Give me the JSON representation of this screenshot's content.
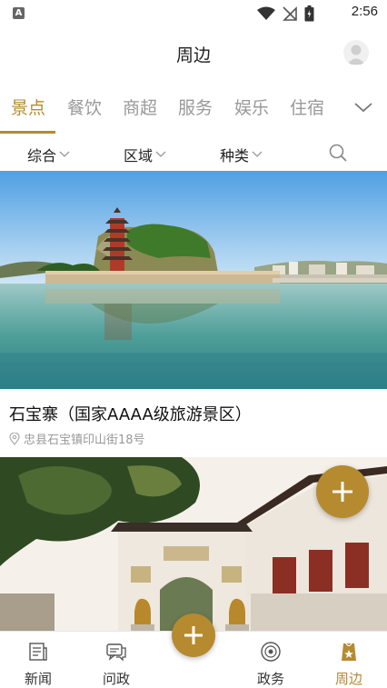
{
  "status_bar": {
    "time": "2:56",
    "notification_letter": "A"
  },
  "header": {
    "title": "周边"
  },
  "category_tabs": [
    {
      "label": "景点",
      "active": true
    },
    {
      "label": "餐饮",
      "active": false
    },
    {
      "label": "商超",
      "active": false
    },
    {
      "label": "服务",
      "active": false
    },
    {
      "label": "娱乐",
      "active": false
    },
    {
      "label": "住宿",
      "active": false
    }
  ],
  "filters": {
    "sort": "综合",
    "area": "区域",
    "type": "种类"
  },
  "listings": [
    {
      "name": "石宝寨（国家AAAA级旅游景区）",
      "address": "忠县石宝镇印山街18号"
    }
  ],
  "bottom_nav": [
    {
      "label": "新闻",
      "icon": "news-icon",
      "active": false
    },
    {
      "label": "问政",
      "icon": "chat-icon",
      "active": false
    },
    {
      "label": "政务",
      "icon": "government-icon",
      "active": false
    },
    {
      "label": "周边",
      "icon": "nearby-icon",
      "active": true
    }
  ],
  "colors": {
    "accent": "#b68a2f",
    "inactive_tab": "#999999",
    "text": "#222222"
  }
}
